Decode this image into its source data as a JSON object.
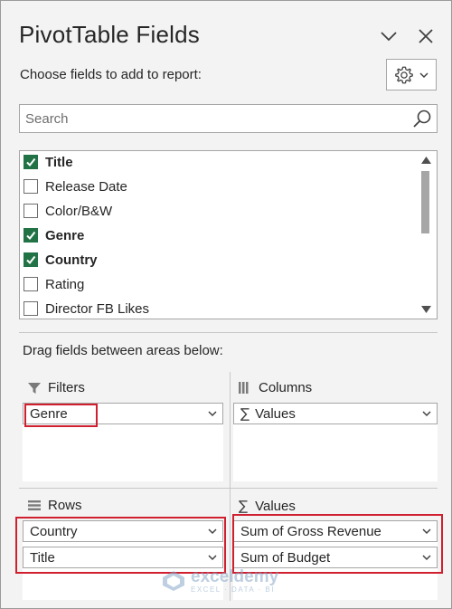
{
  "pane": {
    "title": "PivotTable Fields",
    "choose_label": "Choose fields to add to report:",
    "search_placeholder": "Search"
  },
  "fields": [
    {
      "label": "Title",
      "checked": true
    },
    {
      "label": "Release Date",
      "checked": false
    },
    {
      "label": "Color/B&W",
      "checked": false
    },
    {
      "label": "Genre",
      "checked": true
    },
    {
      "label": "Country",
      "checked": true
    },
    {
      "label": "Rating",
      "checked": false
    },
    {
      "label": "Director FB Likes",
      "checked": false
    }
  ],
  "areas": {
    "drag_label": "Drag fields between areas below:",
    "filters": {
      "label": "Filters",
      "items": [
        "Genre"
      ]
    },
    "columns": {
      "label": "Columns",
      "items": [
        "Values"
      ]
    },
    "rows": {
      "label": "Rows",
      "items": [
        "Country",
        "Title"
      ]
    },
    "values": {
      "label": "Values",
      "items": [
        "Sum of Gross Revenue",
        "Sum of Budget"
      ]
    }
  },
  "watermark": {
    "name": "exceldemy",
    "tagline": "EXCEL · DATA · BI"
  },
  "colors": {
    "check": "#217346",
    "highlight": "#d02030"
  }
}
